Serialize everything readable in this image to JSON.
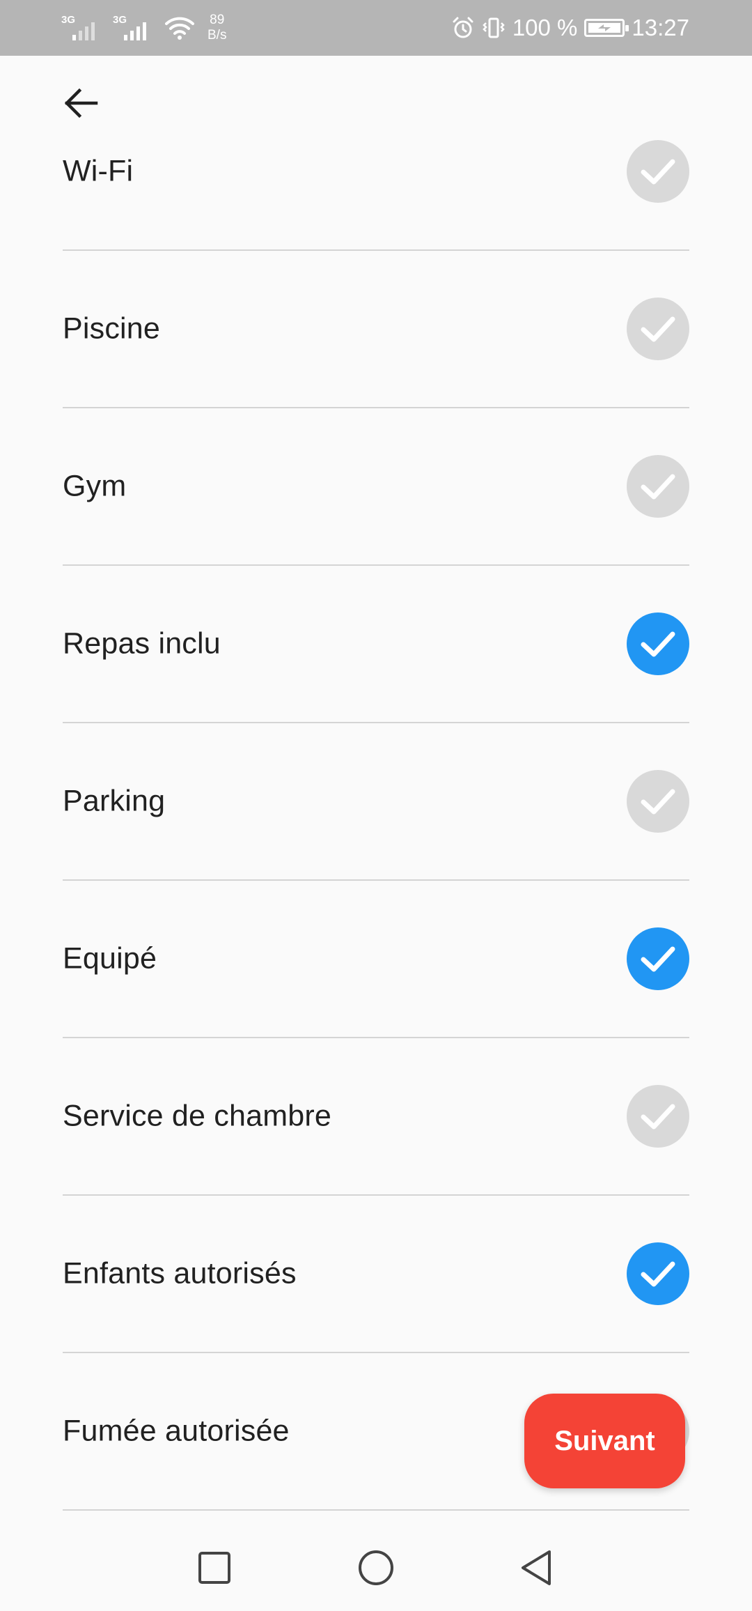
{
  "status_bar": {
    "sim1_label": "3G",
    "sim2_label": "3G",
    "net_speed_value": "89",
    "net_speed_unit": "B/s",
    "battery_text": "100 %",
    "time": "13:27"
  },
  "amenities": [
    {
      "label": "Wi-Fi",
      "checked": false
    },
    {
      "label": "Piscine",
      "checked": false
    },
    {
      "label": "Gym",
      "checked": false
    },
    {
      "label": "Repas inclu",
      "checked": true
    },
    {
      "label": "Parking",
      "checked": false
    },
    {
      "label": "Equipé",
      "checked": true
    },
    {
      "label": "Service de chambre",
      "checked": false
    },
    {
      "label": "Enfants autorisés",
      "checked": true
    },
    {
      "label": "Fumée autorisée",
      "checked": false
    }
  ],
  "next_button_label": "Suivant",
  "colors": {
    "checked": "#2196f3",
    "unchecked": "#d9d9d9",
    "next_button": "#f44336",
    "status_bar": "#b5b5b5"
  }
}
